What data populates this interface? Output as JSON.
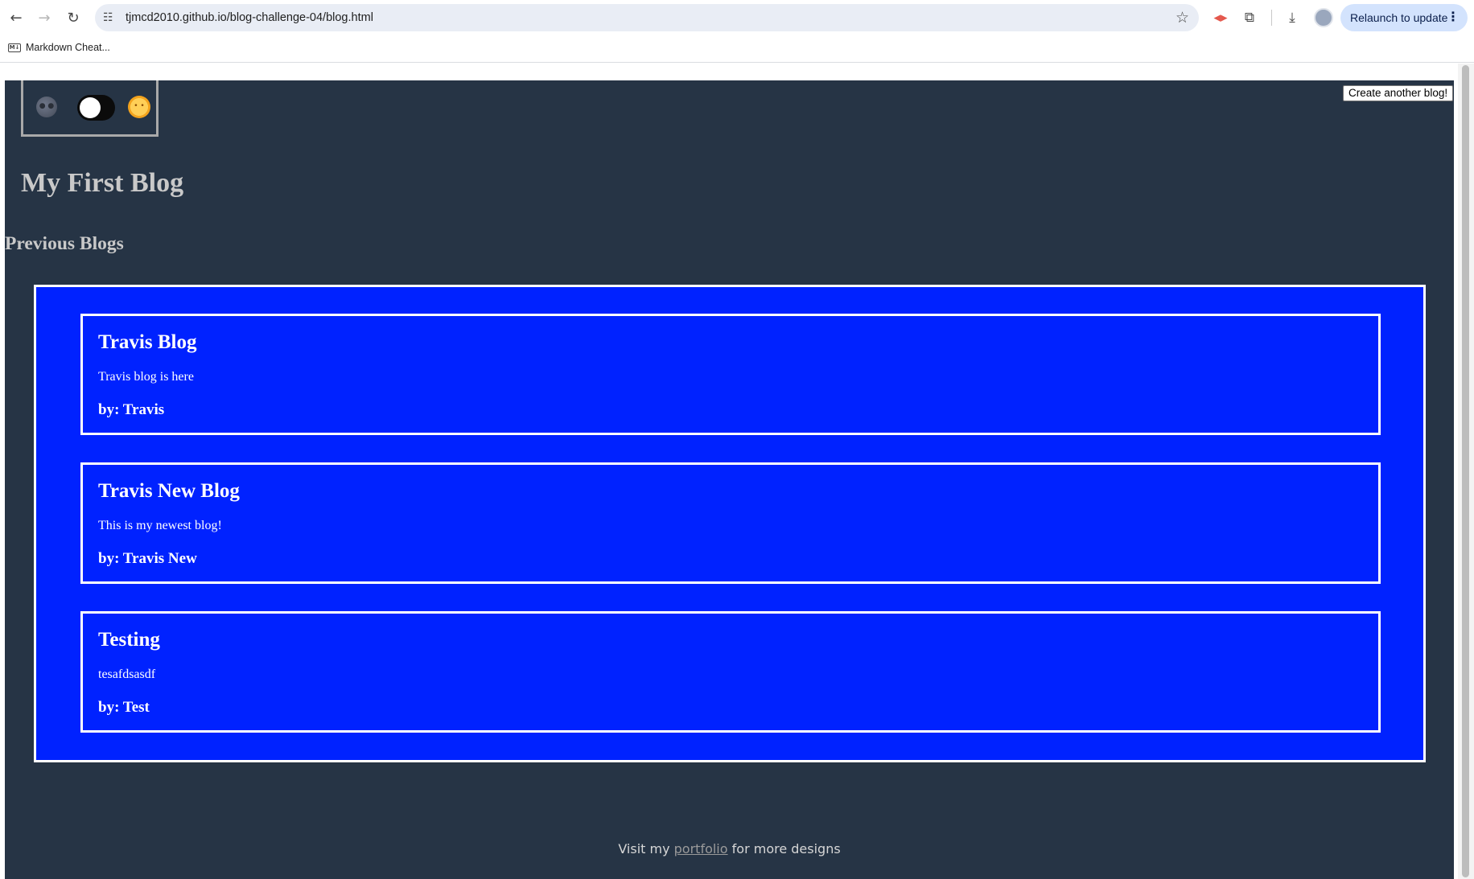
{
  "browser": {
    "url": "tjmcd2010.github.io/blog-challenge-04/blog.html",
    "relaunch_label": "Relaunch to update",
    "bookmarks": [
      {
        "label": "Markdown Cheat..."
      }
    ]
  },
  "page": {
    "create_button_label": "Create another blog!",
    "blog_title": "My First Blog",
    "previous_heading": "Previous Blogs",
    "theme_toggle": {
      "mode": "dark",
      "moon_icon": "moon-icon",
      "sun_icon": "sun-icon"
    },
    "posts": [
      {
        "title": "Travis Blog",
        "content": "Travis blog is here",
        "author": "by: Travis"
      },
      {
        "title": "Travis New Blog",
        "content": "This is my newest blog!",
        "author": "by: Travis New"
      },
      {
        "title": "Testing",
        "content": "tesafdsasdf",
        "author": "by: Test"
      }
    ],
    "footer": {
      "prefix": "Visit my",
      "link": "portfolio",
      "suffix": "for more designs"
    }
  },
  "colors": {
    "page_background": "#263445",
    "posts_background": "#0022ff",
    "border": "#ffffff",
    "heading_text": "#c9c9c9"
  }
}
